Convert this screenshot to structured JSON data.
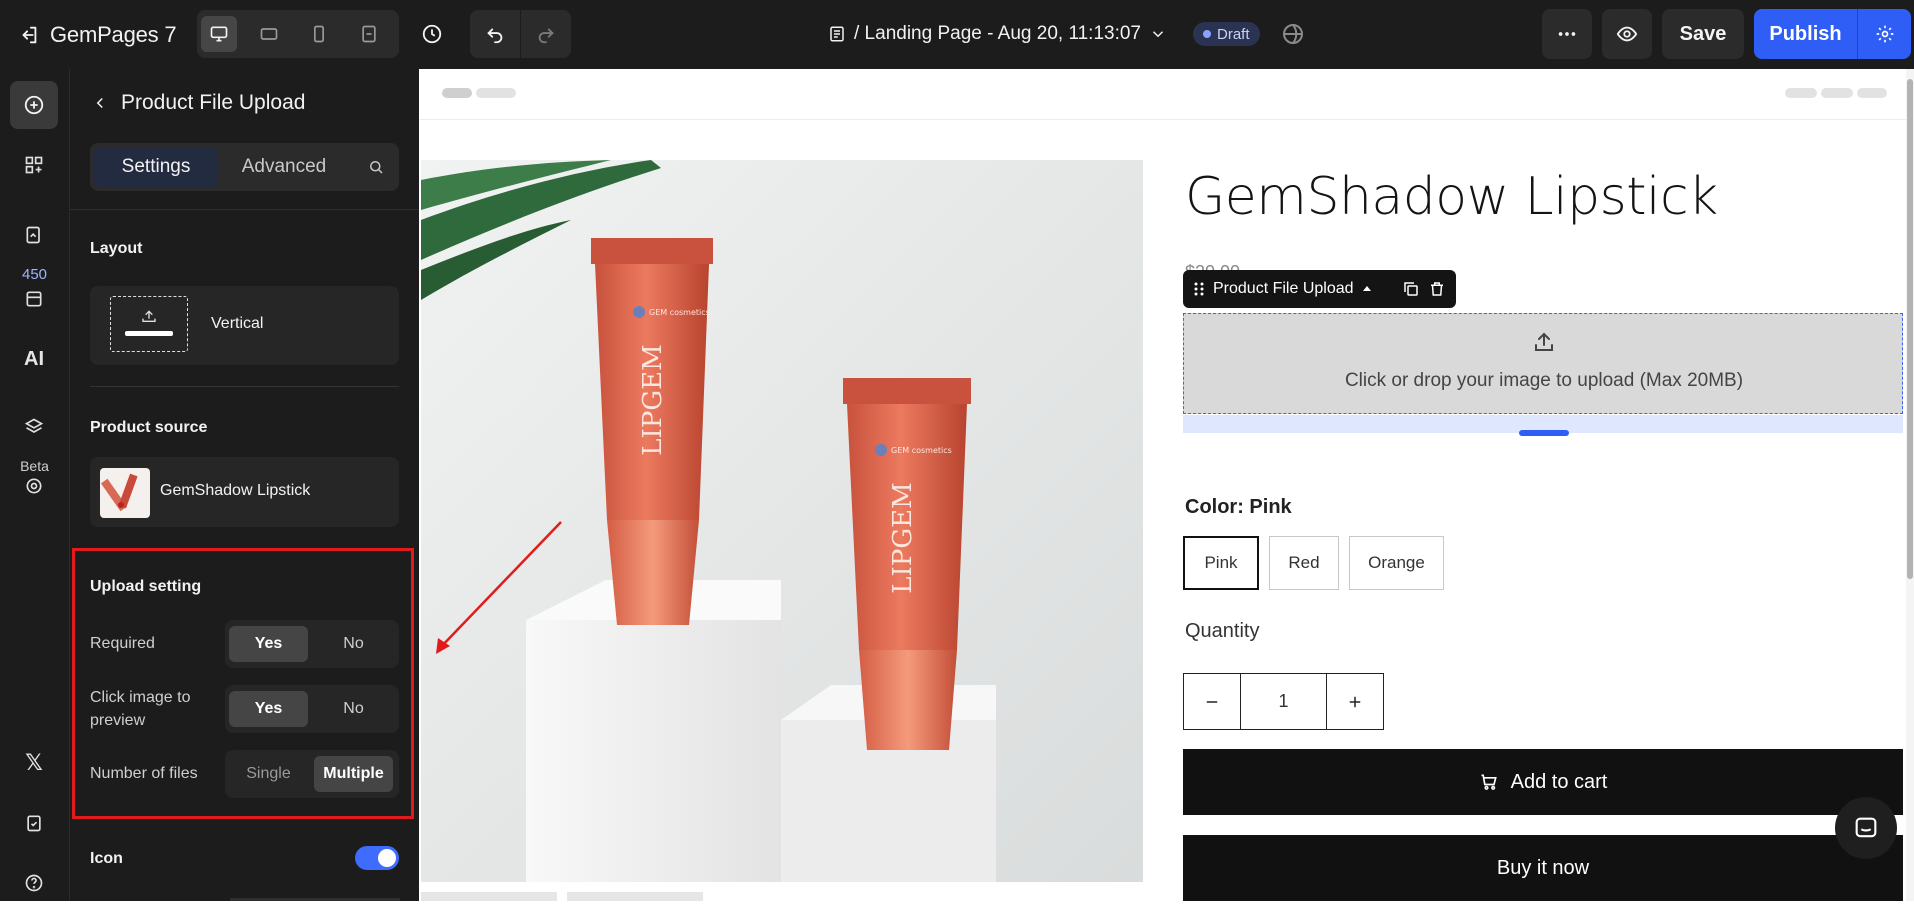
{
  "app": {
    "name": "GemPages 7",
    "page_title": "/ Landing Page - Aug 20, 11:13:07",
    "status_badge": "Draft",
    "save_label": "Save",
    "publish_label": "Publish"
  },
  "colors": {
    "accent": "#2f5ef6",
    "dark_bg": "#1c1c1c",
    "highlight": "#e11b1b"
  },
  "rail": {
    "badge_count": "450",
    "ai_label": "AI",
    "beta_label": "Beta"
  },
  "panel": {
    "title": "Product File Upload",
    "tabs": [
      {
        "label": "Settings",
        "active": true
      },
      {
        "label": "Advanced",
        "active": false
      }
    ],
    "layout": {
      "section": "Layout",
      "value": "Vertical"
    },
    "product_source": {
      "section": "Product source",
      "product": "GemShadow Lipstick"
    },
    "upload_setting": {
      "section": "Upload setting",
      "required": {
        "label": "Required",
        "options": [
          "Yes",
          "No"
        ],
        "selected": "Yes"
      },
      "preview": {
        "label": "Click image to preview",
        "options": [
          "Yes",
          "No"
        ],
        "selected": "Yes"
      },
      "files": {
        "label": "Number of files",
        "options": [
          "Single",
          "Multiple"
        ],
        "selected": "Multiple"
      }
    },
    "icon": {
      "section": "Icon",
      "enabled": true
    }
  },
  "canvas": {
    "product_title": "GemShadow Lipstick",
    "price_partial": "$20.00",
    "element_toolbar_label": "Product File Upload",
    "upload_text": "Click or drop your image to upload (Max 20MB)",
    "color_label": "Color: Pink",
    "colors": [
      "Pink",
      "Red",
      "Orange"
    ],
    "selected_color": "Pink",
    "quantity_label": "Quantity",
    "quantity_value": "1",
    "add_to_cart": "Add to cart",
    "buy_now": "Buy it now",
    "tube_brand": "LIPGEM",
    "tube_logo": "GEM cosmetics"
  }
}
